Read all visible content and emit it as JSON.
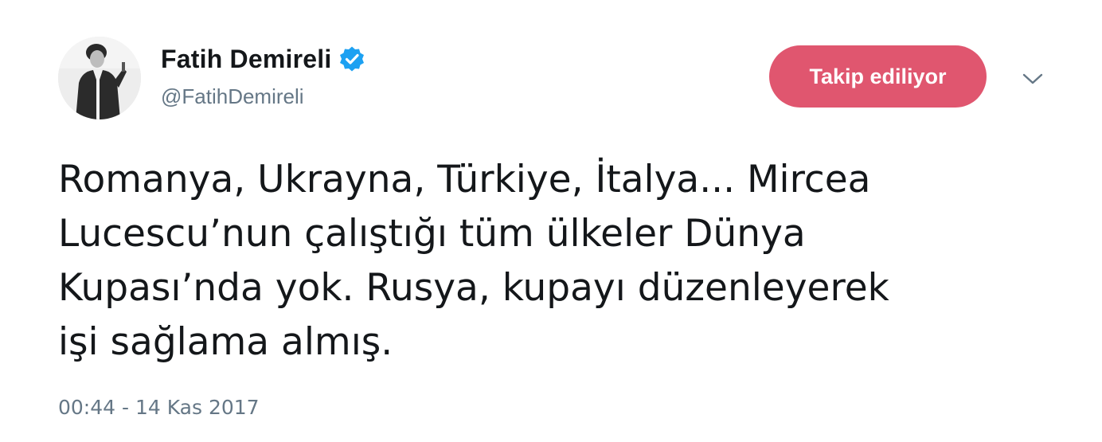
{
  "user": {
    "display_name": "Fatih Demireli",
    "handle": "@FatihDemireli",
    "verified_icon": "verified-badge-icon",
    "avatar_icon": "profile-photo"
  },
  "actions": {
    "follow_label": "Takip ediliyor",
    "more_icon": "chevron-down-icon"
  },
  "tweet": {
    "lines": [
      "Romanya, Ukrayna, Türkiye, İtalya... Mircea",
      "Lucescu’nun çalıştığı tüm ülkeler Dünya",
      "Kupası’nda yok. Rusya, kupayı düzenleyerek",
      "işi sağlama almış."
    ],
    "timestamp": "00:44 - 14 Kas 2017"
  },
  "colors": {
    "follow_button": "#e0566f",
    "verified": "#1da1f2",
    "secondary_text": "#657786",
    "primary_text": "#14171a"
  }
}
